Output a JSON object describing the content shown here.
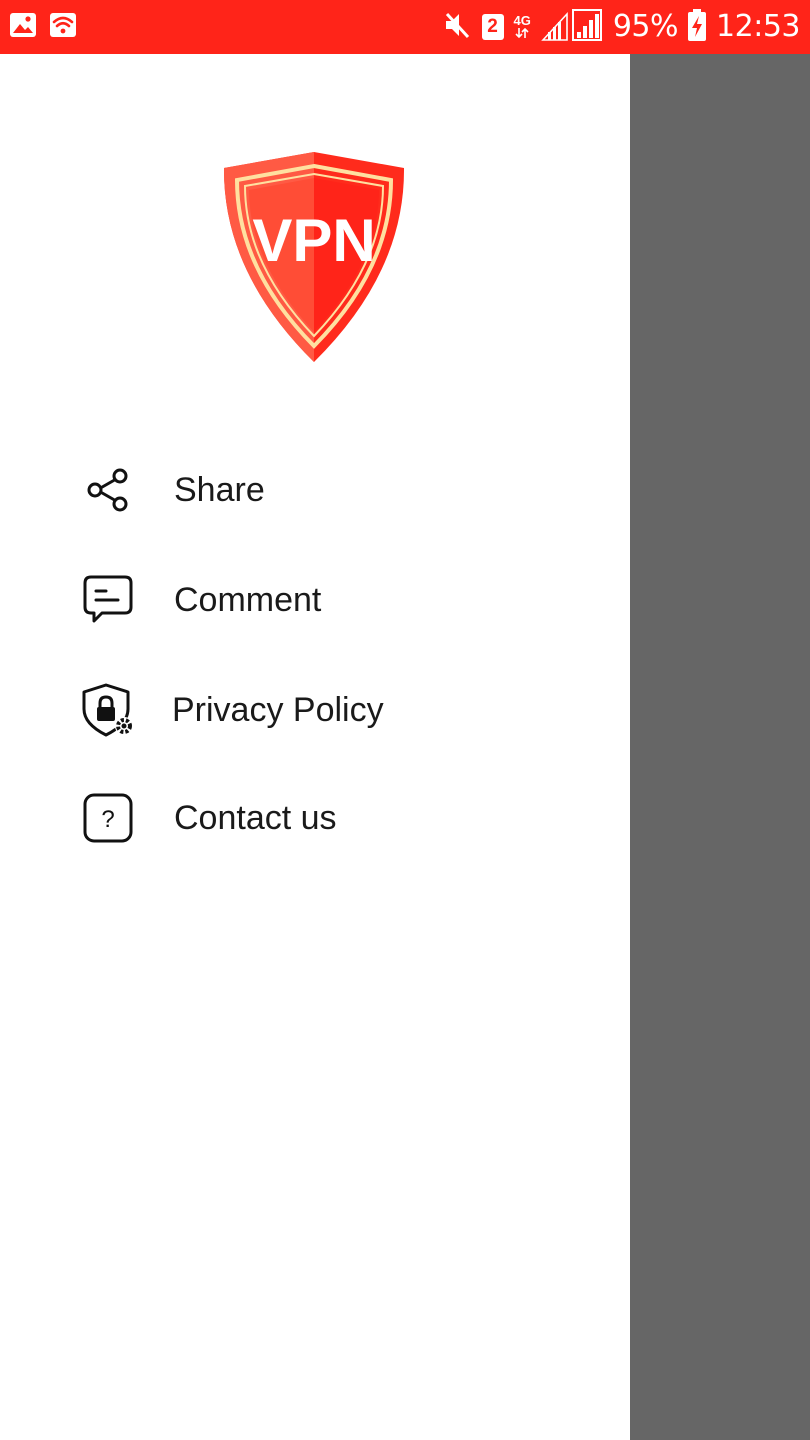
{
  "status_bar": {
    "sim_slot": "2",
    "network_type": "4G",
    "battery_percent": "95%",
    "time": "12:53",
    "icons": [
      "image-icon",
      "wifi-icon",
      "mute-icon",
      "signal-icon",
      "battery-charging-icon"
    ]
  },
  "drawer": {
    "logo_text": "VPN",
    "menu": [
      {
        "label": "Share",
        "icon": "share-icon"
      },
      {
        "label": "Comment",
        "icon": "comment-icon"
      },
      {
        "label": "Privacy Policy",
        "icon": "privacy-shield-icon"
      },
      {
        "label": "Contact us",
        "icon": "help-icon"
      }
    ]
  },
  "colors": {
    "status_bar": "#ff2419",
    "scrim": "#666666",
    "drawer_bg": "#ffffff",
    "logo_red": "#ff2b1c",
    "logo_trim": "#ffe0a0",
    "text": "#1a1a1a"
  }
}
